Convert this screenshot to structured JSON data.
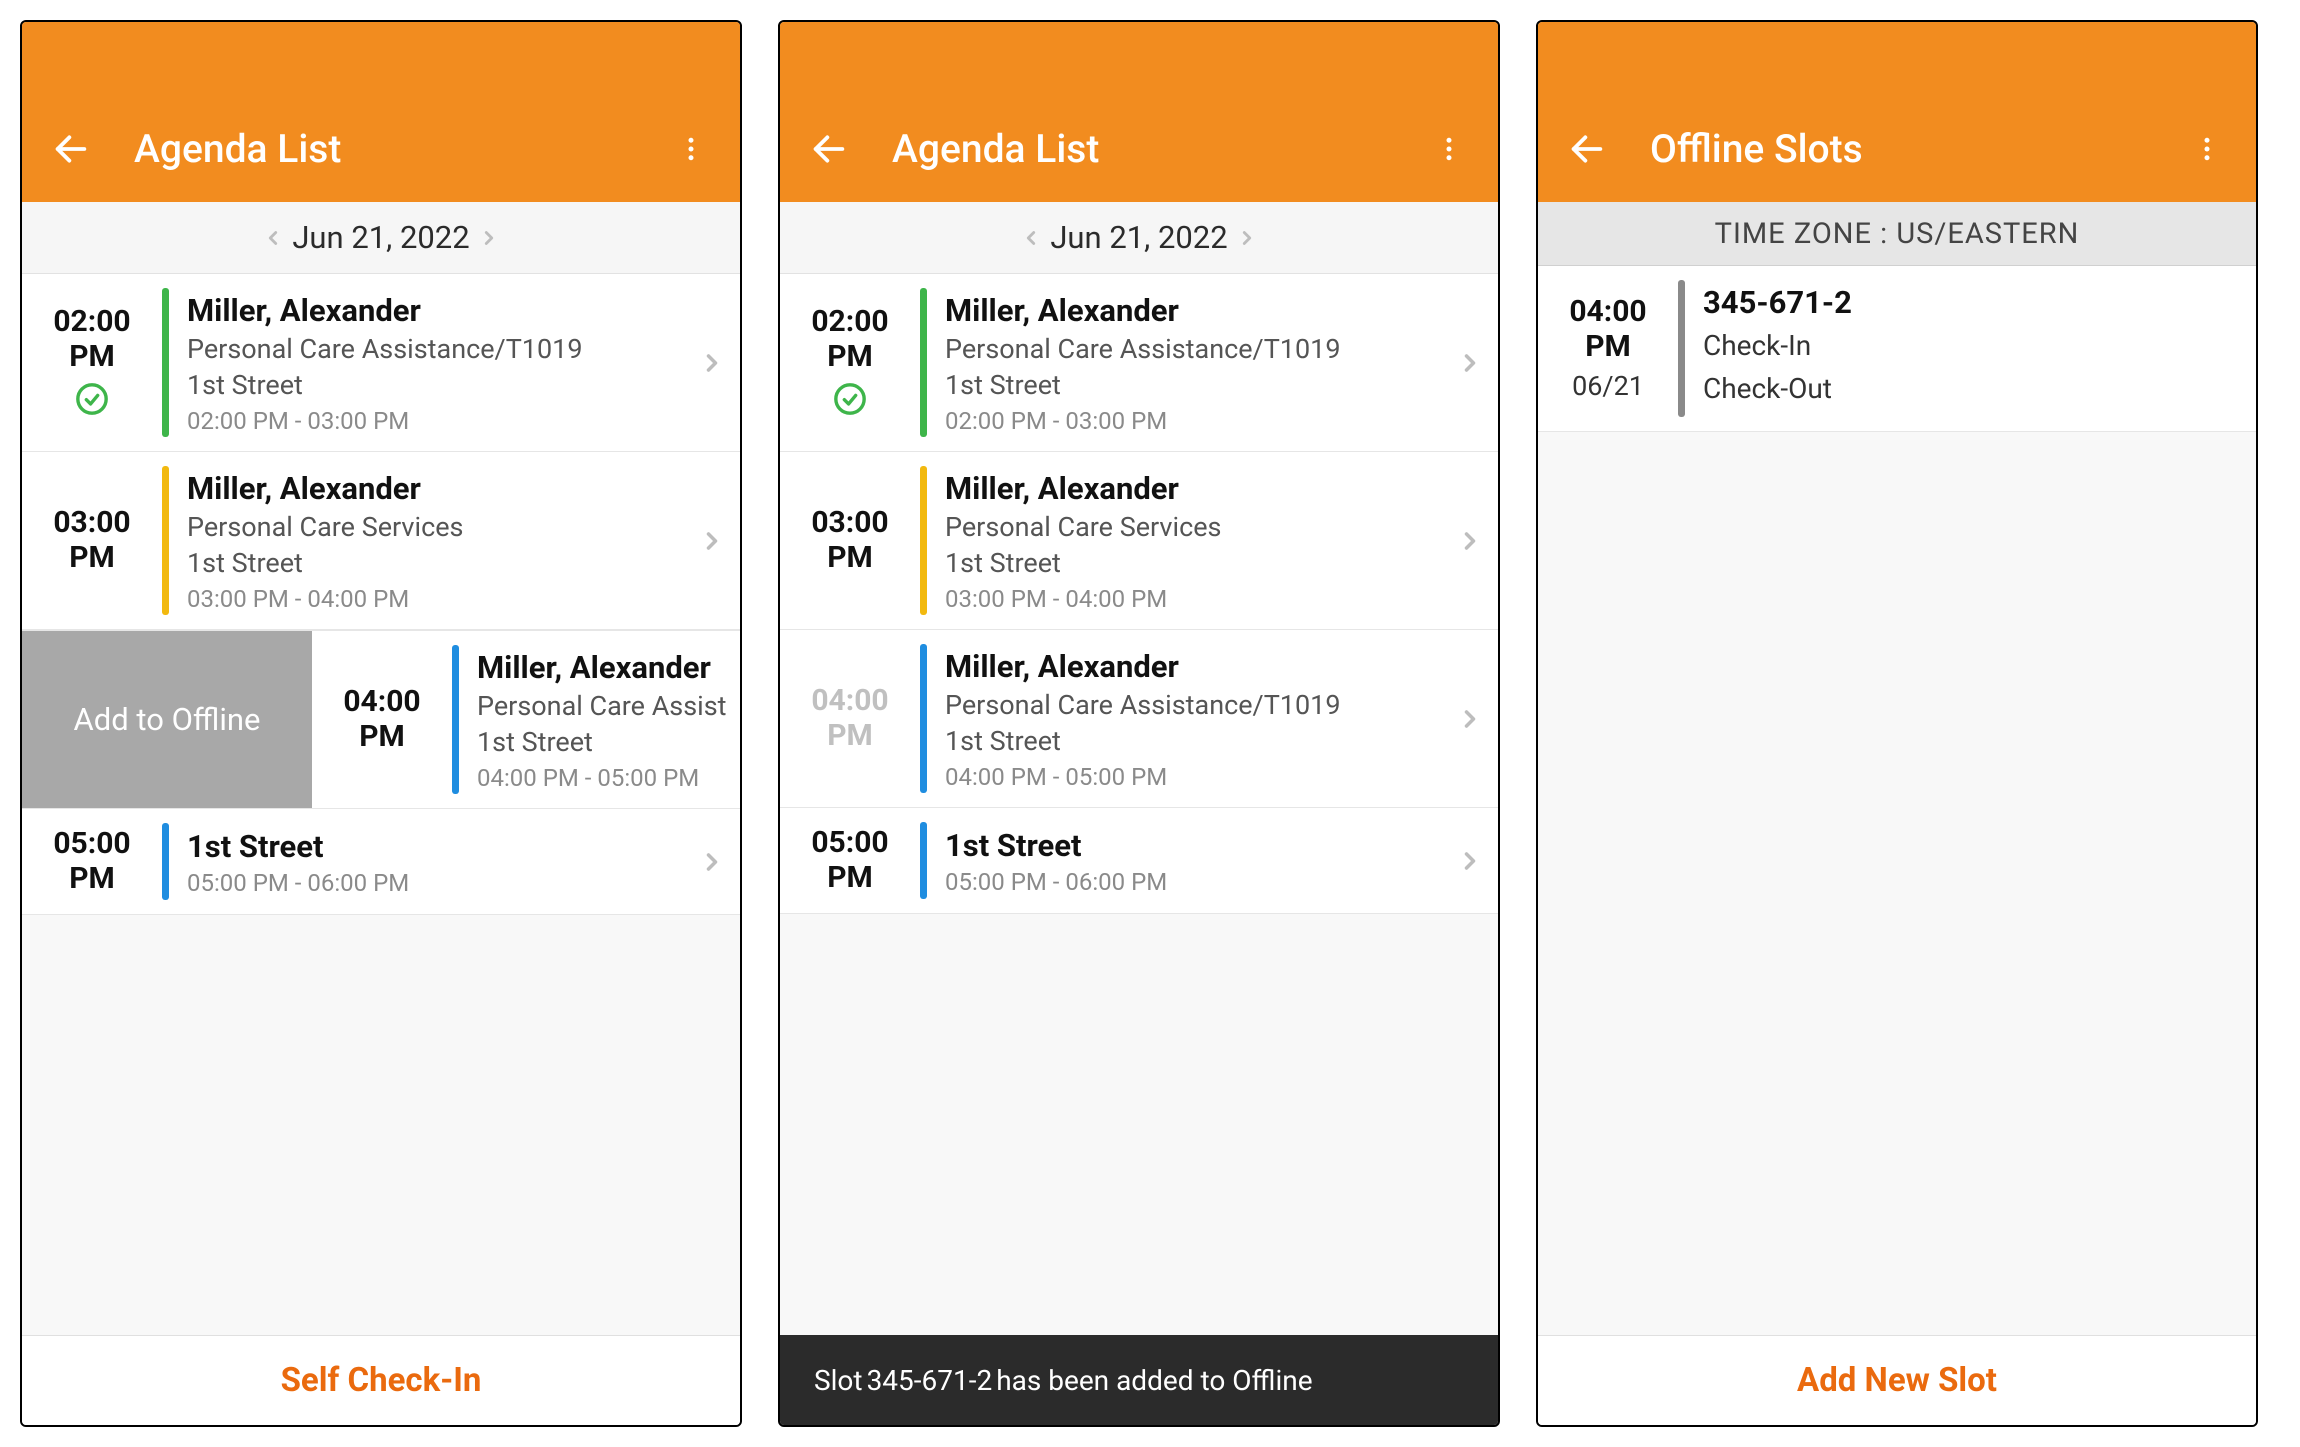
{
  "screen1": {
    "title": "Agenda List",
    "date": "Jun 21, 2022",
    "footer": "Self Check-In",
    "swipe_label": "Add to Offline",
    "items": [
      {
        "time1": "02:00",
        "time2": "PM",
        "name": "Miller, Alexander",
        "svc": "Personal Care Assistance/T1019",
        "addr": "1st Street",
        "range": "02:00 PM - 03:00 PM",
        "stripe": "green",
        "check": true
      },
      {
        "time1": "03:00",
        "time2": "PM",
        "name": "Miller, Alexander",
        "svc": "Personal Care Services",
        "addr": "1st Street",
        "range": "03:00 PM - 04:00 PM",
        "stripe": "yellow",
        "check": false
      },
      {
        "time1": "04:00",
        "time2": "PM",
        "name": "Miller, Alexander",
        "svc": "Personal Care Assist",
        "addr": "1st Street",
        "range": "04:00 PM - 05:00 PM",
        "stripe": "blue",
        "check": false
      },
      {
        "time1": "05:00",
        "time2": "PM",
        "name": "1st Street",
        "svc": "",
        "addr": "",
        "range": "05:00 PM - 06:00 PM",
        "stripe": "blue",
        "check": false
      }
    ]
  },
  "screen2": {
    "title": "Agenda List",
    "date": "Jun 21, 2022",
    "toast_prefix": "Slot ",
    "toast_id": "345-671-2",
    "toast_suffix": " has been added to Offline",
    "items": [
      {
        "time1": "02:00",
        "time2": "PM",
        "name": "Miller, Alexander",
        "svc": "Personal Care Assistance/T1019",
        "addr": "1st Street",
        "range": "02:00 PM - 03:00 PM",
        "stripe": "green",
        "check": true,
        "dim": false
      },
      {
        "time1": "03:00",
        "time2": "PM",
        "name": "Miller, Alexander",
        "svc": "Personal Care Services",
        "addr": "1st Street",
        "range": "03:00 PM - 04:00 PM",
        "stripe": "yellow",
        "check": false,
        "dim": false
      },
      {
        "time1": "04:00",
        "time2": "PM",
        "name": "Miller, Alexander",
        "svc": "Personal Care Assistance/T1019",
        "addr": "1st Street",
        "range": "04:00 PM - 05:00 PM",
        "stripe": "blue",
        "check": false,
        "dim": true
      },
      {
        "time1": "05:00",
        "time2": "PM",
        "name": "1st Street",
        "svc": "",
        "addr": "",
        "range": "05:00 PM - 06:00 PM",
        "stripe": "blue",
        "check": false,
        "dim": false
      }
    ]
  },
  "screen3": {
    "title": "Offline Slots",
    "tz": "TIME ZONE : US/EASTERN",
    "footer": "Add New Slot",
    "slot": {
      "time1": "04:00",
      "time2": "PM",
      "date": "06/21",
      "id": "345-671-2",
      "line1": "Check-In",
      "line2": "Check-Out"
    }
  }
}
